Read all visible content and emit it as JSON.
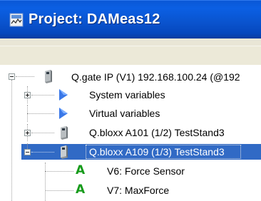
{
  "window": {
    "title": "Project: DAMeas12"
  },
  "tree": {
    "root": {
      "label": "Q.gate IP (V1) 192.168.100.24 (@192",
      "expanded": true,
      "icon": "device-icon"
    },
    "items": [
      {
        "label": "System variables",
        "icon": "arrow-icon",
        "expander": "plus"
      },
      {
        "label": "Virtual variables",
        "icon": "arrow-icon",
        "expander": "none"
      },
      {
        "label": "Q.bloxx A101 (1/2) TestStand3",
        "icon": "device-icon",
        "expander": "plus"
      },
      {
        "label": "Q.bloxx A109 (1/3) TestStand3",
        "icon": "device-icon",
        "expander": "minus",
        "selected": true
      },
      {
        "label": "V6: Force Sensor",
        "icon": "analog-channel-icon",
        "glyph": "A"
      },
      {
        "label": "V7: MaxForce",
        "icon": "analog-channel-icon",
        "glyph": "A"
      }
    ]
  },
  "colors": {
    "titlebar": "#0a58d6",
    "selection": "#316ac5",
    "arrow": "#3a78e8",
    "analog": "#179b1b"
  }
}
